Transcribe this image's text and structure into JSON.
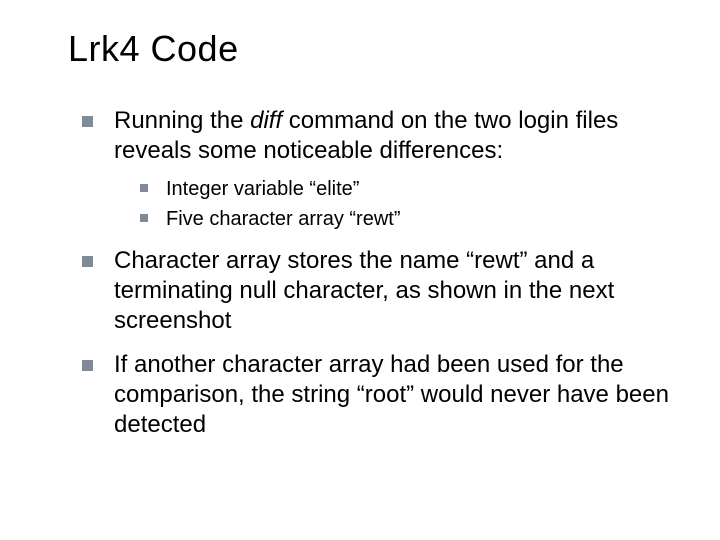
{
  "title": "Lrk4 Code",
  "bullets": {
    "b1_pre": "Running the ",
    "b1_em": "diff",
    "b1_post": " command on the two login files reveals some noticeable differences:",
    "b1_sub1": "Integer variable “elite”",
    "b1_sub2": "Five character array “rewt”",
    "b2": "Character array stores the name “rewt” and a terminating null character, as shown in the next screenshot",
    "b3": "If another character array had been used for the comparison, the string “root” would never have been detected"
  }
}
